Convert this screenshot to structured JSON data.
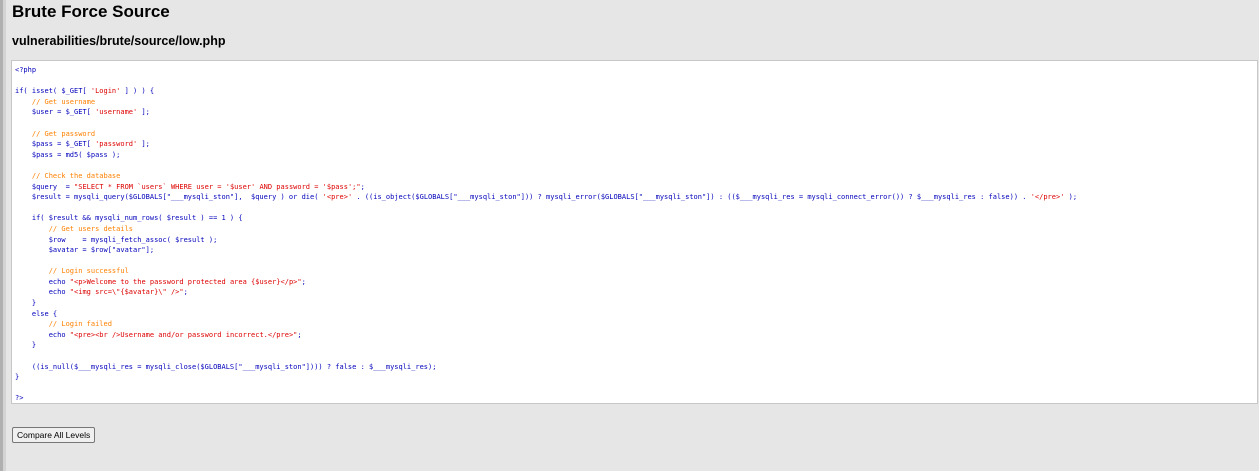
{
  "page": {
    "title": "Brute Force Source",
    "subtitle": "vulnerabilities/brute/source/low.php"
  },
  "code": {
    "lines": [
      [
        [
          "v",
          "<?php"
        ]
      ],
      [],
      [
        [
          "v",
          "if( isset( $_GET[ "
        ],
        [
          "s",
          "'Login'"
        ],
        [
          "v",
          " ] ) ) {"
        ]
      ],
      [
        [
          "c",
          "    // Get username"
        ]
      ],
      [
        [
          "v",
          "    $user = $_GET[ "
        ],
        [
          "s",
          "'username'"
        ],
        [
          "v",
          " ];"
        ]
      ],
      [],
      [
        [
          "c",
          "    // Get password"
        ]
      ],
      [
        [
          "v",
          "    $pass = $_GET[ "
        ],
        [
          "s",
          "'password'"
        ],
        [
          "v",
          " ];"
        ]
      ],
      [
        [
          "v",
          "    $pass = md5( $pass );"
        ]
      ],
      [],
      [
        [
          "c",
          "    // Check the database"
        ]
      ],
      [
        [
          "v",
          "    $query  = "
        ],
        [
          "s",
          "\"SELECT * FROM `users` WHERE user = '$user' AND password = '$pass';\""
        ],
        [
          "v",
          ";"
        ]
      ],
      [
        [
          "v",
          "    $result = mysqli_query($GLOBALS[\"___mysqli_ston\"],  $query ) or die( "
        ],
        [
          "s",
          "'<pre>'"
        ],
        [
          "v",
          " . ((is_object($GLOBALS[\"___mysqli_ston\"])) ? mysqli_error($GLOBALS[\"___mysqli_ston\"]) : (($___mysqli_res = mysqli_connect_error()) ? $___mysqli_res : false)) . "
        ],
        [
          "s",
          "'</pre>'"
        ],
        [
          "v",
          " );"
        ]
      ],
      [],
      [
        [
          "v",
          "    if( $result && mysqli_num_rows( $result ) == 1 ) {"
        ]
      ],
      [
        [
          "c",
          "        // Get users details"
        ]
      ],
      [
        [
          "v",
          "        $row    = mysqli_fetch_assoc( $result );"
        ]
      ],
      [
        [
          "v",
          "        $avatar = $row[\"avatar\"];"
        ]
      ],
      [],
      [
        [
          "c",
          "        // Login successful"
        ]
      ],
      [
        [
          "v",
          "        echo "
        ],
        [
          "s",
          "\"<p>Welcome to the password protected area {$user}</p>\""
        ],
        [
          "v",
          ";"
        ]
      ],
      [
        [
          "v",
          "        echo "
        ],
        [
          "s",
          "\"<img src=\\\"{$avatar}\\\" />\""
        ],
        [
          "v",
          ";"
        ]
      ],
      [
        [
          "v",
          "    }"
        ]
      ],
      [
        [
          "v",
          "    else {"
        ]
      ],
      [
        [
          "c",
          "        // Login failed"
        ]
      ],
      [
        [
          "v",
          "        echo "
        ],
        [
          "s",
          "\"<pre><br />Username and/or password incorrect.</pre>\""
        ],
        [
          "v",
          ";"
        ]
      ],
      [
        [
          "v",
          "    }"
        ]
      ],
      [],
      [
        [
          "v",
          "    ((is_null($___mysqli_res = mysqli_close($GLOBALS[\"___mysqli_ston\"]))) ? false : $___mysqli_res);"
        ]
      ],
      [
        [
          "v",
          "}"
        ]
      ],
      [],
      [
        [
          "v",
          "?>"
        ]
      ]
    ]
  },
  "buttons": {
    "compare": "Compare All Levels"
  },
  "colors": {
    "keyword": "#007700",
    "comment": "#ff8000",
    "string": "#dd0000",
    "default": "#0000bb"
  }
}
